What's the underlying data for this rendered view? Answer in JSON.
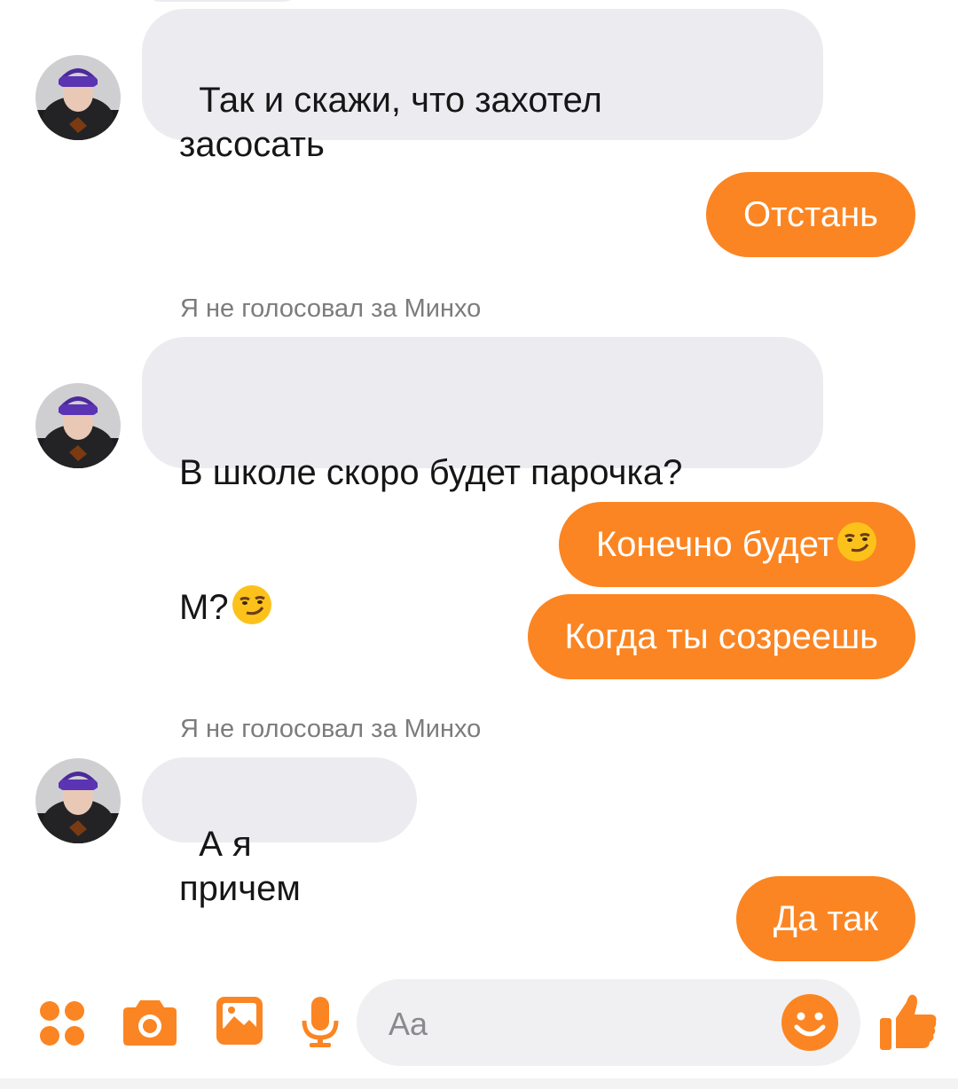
{
  "conversation": {
    "sender_name": "Я не голосовал за Минхо",
    "msg1": "Так и скажи, что захотел\nзасосать",
    "msg2": "Отстань",
    "msg3_line1": "В школе скоро будет парочка?",
    "msg3_line2": "М?",
    "msg4": "Конечно будет",
    "msg5": "Когда ты созреешь",
    "msg6": "А я причем",
    "msg7": "Да так"
  },
  "composer": {
    "placeholder": "Aa"
  },
  "colors": {
    "accent": "#fb8522",
    "incoming_bubble": "#ececf0",
    "input_background": "#f0f0f2"
  },
  "icons": {
    "apps": "apps-dots-icon",
    "camera": "camera-icon",
    "gallery": "image-gallery-icon",
    "microphone": "microphone-icon",
    "emoji": "smiley-icon",
    "like": "thumbs-up-icon",
    "inline_emoji": "smirking-face-emoji"
  }
}
